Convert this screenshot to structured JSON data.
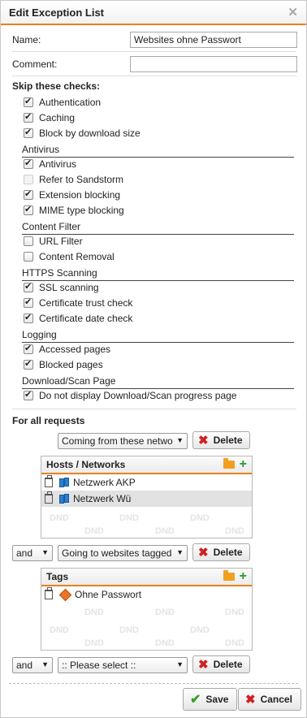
{
  "dialog": {
    "title": "Edit Exception List",
    "close_glyph": "✕"
  },
  "form": {
    "name_label": "Name:",
    "name_value": "Websites ohne Passwort",
    "comment_label": "Comment:",
    "comment_value": ""
  },
  "skip_heading": "Skip these checks:",
  "checks_general": [
    {
      "label": "Authentication",
      "checked": true
    },
    {
      "label": "Caching",
      "checked": true
    },
    {
      "label": "Block by download size",
      "checked": true
    }
  ],
  "sections": {
    "antivirus": "Antivirus",
    "content_filter": "Content Filter",
    "https": "HTTPS Scanning",
    "logging": "Logging",
    "download": "Download/Scan Page"
  },
  "checks_antivirus": [
    {
      "label": "Antivirus",
      "checked": true,
      "disabled": false
    },
    {
      "label": "Refer to Sandstorm",
      "checked": false,
      "disabled": true
    },
    {
      "label": "Extension blocking",
      "checked": true,
      "disabled": false
    },
    {
      "label": "MIME type blocking",
      "checked": true,
      "disabled": false
    }
  ],
  "checks_content_filter": [
    {
      "label": "URL Filter",
      "checked": false
    },
    {
      "label": "Content Removal",
      "checked": false
    }
  ],
  "checks_https": [
    {
      "label": "SSL scanning",
      "checked": true
    },
    {
      "label": "Certificate trust check",
      "checked": true
    },
    {
      "label": "Certificate date check",
      "checked": true
    }
  ],
  "checks_logging": [
    {
      "label": "Accessed pages",
      "checked": true
    },
    {
      "label": "Blocked pages",
      "checked": true
    }
  ],
  "checks_download": [
    {
      "label": "Do not display Download/Scan progress page",
      "checked": true
    }
  ],
  "requests": {
    "heading": "For all requests",
    "condition1": {
      "select": "Coming from these netwo",
      "delete_label": "Delete"
    },
    "hosts_panel": {
      "title": "Hosts / Networks",
      "items": [
        "Netzwerk AKP",
        "Netzwerk Wü"
      ],
      "dnd_label": "DND"
    },
    "condition2": {
      "joiner": "and",
      "select": "Going to websites tagged",
      "delete_label": "Delete"
    },
    "tags_panel": {
      "title": "Tags",
      "items": [
        "Ohne Passwort"
      ],
      "dnd_label": "DND"
    },
    "condition3": {
      "joiner": "and",
      "select": ":: Please select ::",
      "delete_label": "Delete"
    }
  },
  "footer": {
    "save_label": "Save",
    "cancel_label": "Cancel"
  },
  "colors": {
    "accent": "#e8821c",
    "delete_red": "#d02020",
    "save_green": "#3aa028"
  }
}
